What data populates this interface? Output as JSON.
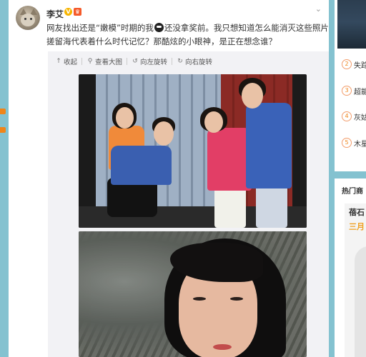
{
  "post": {
    "username": "李艾",
    "vip_badge": "V",
    "crown_badge": "♛",
    "text_line1_a": "网友找出还是“嫩模”时期的我",
    "text_line1_b": "还没拿奖前。我只想知道怎么能消灭这些照片…那",
    "text_line2": "搓留海代表着什么时代记忆？那酷炫的小眼神，是正在想念谁？"
  },
  "toolbar": {
    "collapse": "收起",
    "view_large": "查看大图",
    "rotate_left": "向左旋转",
    "rotate_right": "向右旋转"
  },
  "sidebar": {
    "trending": [
      {
        "rank": "2",
        "text": "失踪"
      },
      {
        "rank": "3",
        "text": "超能"
      },
      {
        "rank": "4",
        "text": "灰姑"
      },
      {
        "rank": "5",
        "text": "木星"
      }
    ],
    "hot_products_title": "热门商",
    "ad_text_1": "蓓石",
    "ad_text_2": "三月"
  },
  "colors": {
    "page_bg": "#84c2d0",
    "accent_orange": "#f08519",
    "vip_yellow": "#f7b500"
  }
}
